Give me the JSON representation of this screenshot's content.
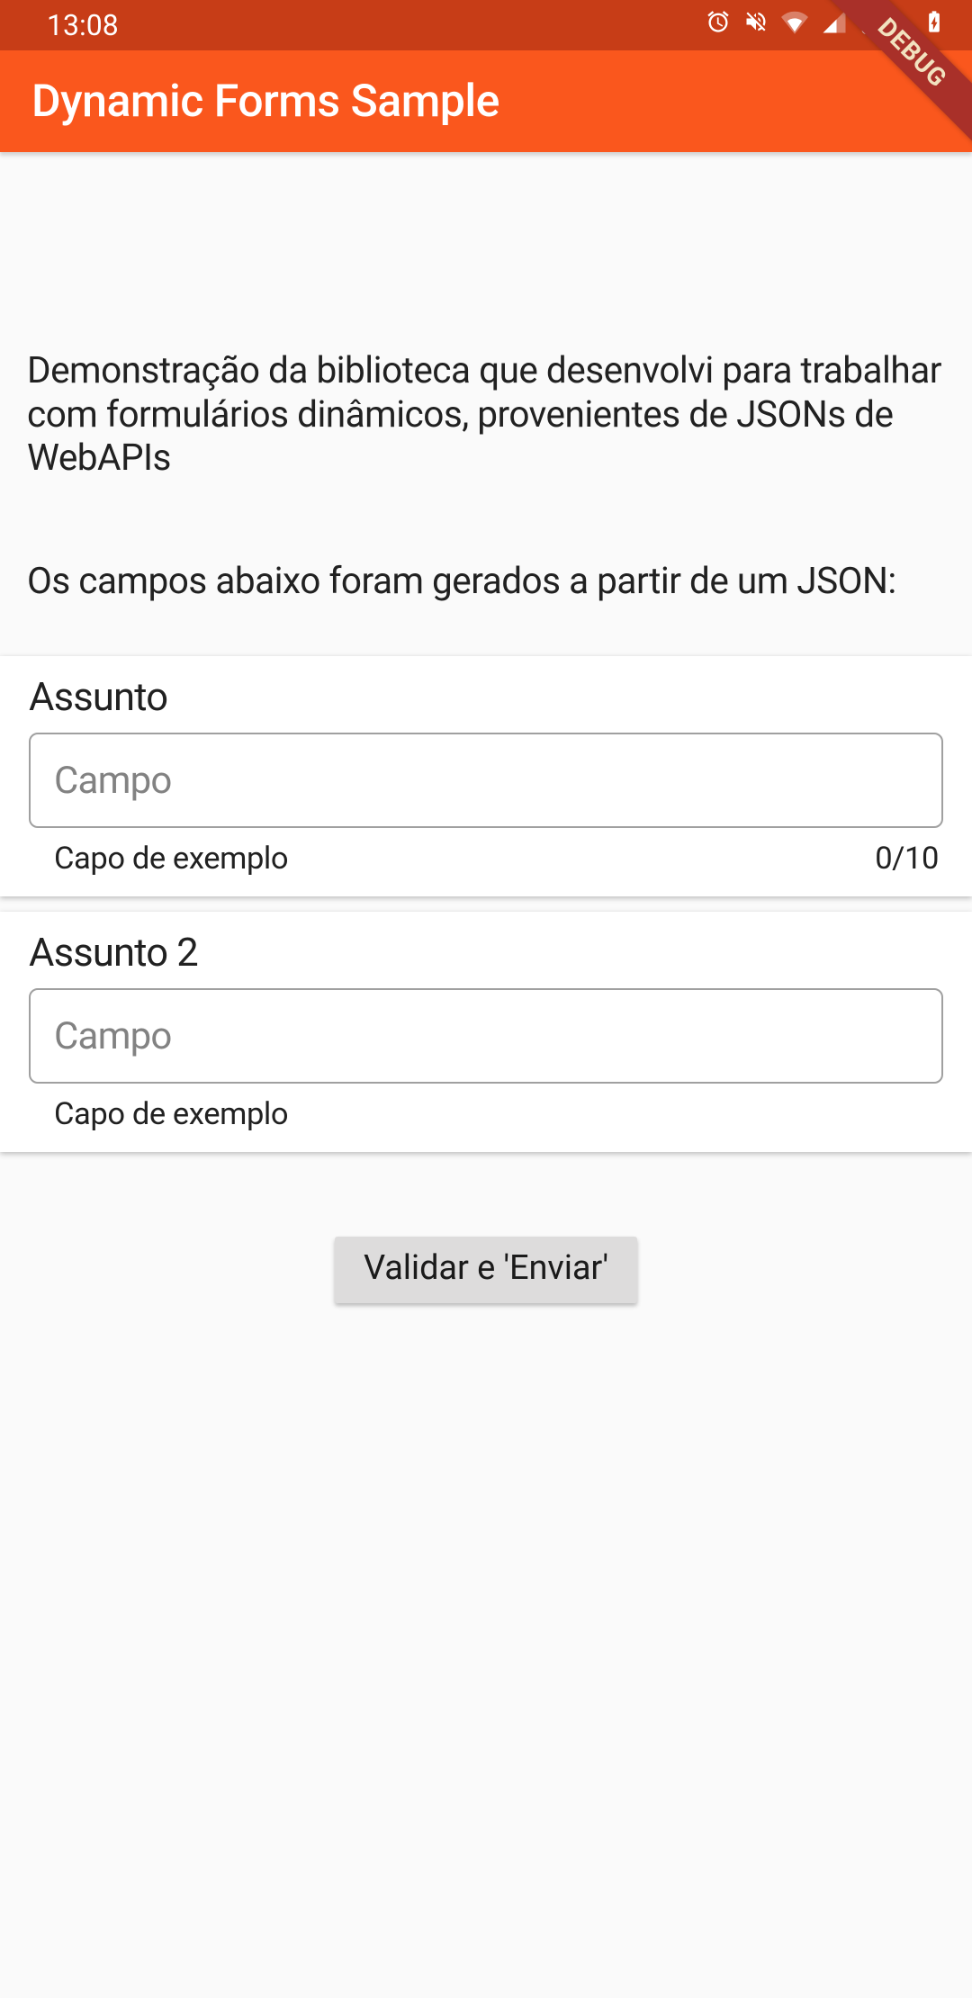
{
  "status_bar": {
    "time": "13:08",
    "battery_percent": "84%"
  },
  "debug_banner": "DEBUG",
  "app_bar": {
    "title": "Dynamic Forms Sample"
  },
  "intro": {
    "line1": "Demonstração da biblioteca que desenvolvi para trabalhar com formulários dinâmicos, provenientes de JSONs de WebAPIs",
    "line2": "Os campos abaixo foram gerados a partir de um JSON:"
  },
  "form": {
    "fields": [
      {
        "label": "Assunto",
        "placeholder": "Campo",
        "helper": "Capo de exemplo",
        "counter": "0/10"
      },
      {
        "label": "Assunto 2",
        "placeholder": "Campo",
        "helper": "Capo de exemplo",
        "counter": ""
      }
    ],
    "submit_label": "Validar e 'Enviar'"
  }
}
